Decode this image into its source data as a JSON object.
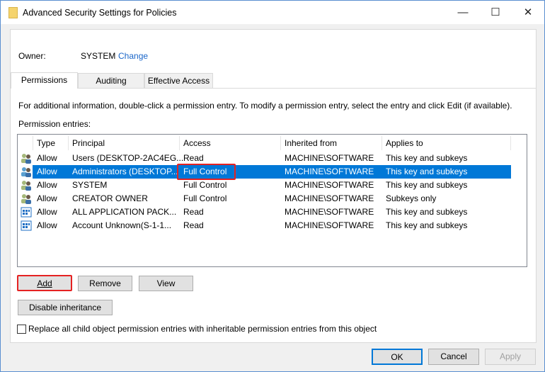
{
  "window": {
    "title": "Advanced Security Settings for Policies",
    "minimize": "—",
    "maximize": "☐",
    "close": "✕"
  },
  "owner": {
    "label": "Owner:",
    "value": "SYSTEM",
    "change_link": "Change"
  },
  "tabs": [
    {
      "label": "Permissions",
      "active": true
    },
    {
      "label": "Auditing"
    },
    {
      "label": "Effective Access"
    }
  ],
  "info_text": "For additional information, double-click a permission entry. To modify a permission entry, select the entry and click Edit (if available).",
  "entries_label": "Permission entries:",
  "columns": [
    "Type",
    "Principal",
    "Access",
    "Inherited from",
    "Applies to"
  ],
  "rows": [
    {
      "icon": "users-icon",
      "type": "Allow",
      "principal": "Users (DESKTOP-2AC4EG...",
      "access": "Read",
      "inherited": "MACHINE\\SOFTWARE",
      "applies": "This key and subkeys"
    },
    {
      "icon": "users-icon",
      "type": "Allow",
      "principal": "Administrators (DESKTOP...",
      "access": "Full Control",
      "inherited": "MACHINE\\SOFTWARE",
      "applies": "This key and subkeys",
      "selected": true
    },
    {
      "icon": "users-icon",
      "type": "Allow",
      "principal": "SYSTEM",
      "access": "Full Control",
      "inherited": "MACHINE\\SOFTWARE",
      "applies": "This key and subkeys"
    },
    {
      "icon": "users-icon",
      "type": "Allow",
      "principal": "CREATOR OWNER",
      "access": "Full Control",
      "inherited": "MACHINE\\SOFTWARE",
      "applies": "Subkeys only"
    },
    {
      "icon": "app-package-icon",
      "type": "Allow",
      "principal": "ALL APPLICATION PACK...",
      "access": "Read",
      "inherited": "MACHINE\\SOFTWARE",
      "applies": "This key and subkeys"
    },
    {
      "icon": "app-package-icon",
      "type": "Allow",
      "principal": "Account Unknown(S-1-1...",
      "access": "Read",
      "inherited": "MACHINE\\SOFTWARE",
      "applies": "This key and subkeys"
    }
  ],
  "buttons": {
    "add": "Add",
    "remove": "Remove",
    "view": "View",
    "disable_inheritance": "Disable inheritance",
    "ok": "OK",
    "cancel": "Cancel",
    "apply": "Apply"
  },
  "replace_checkbox": {
    "label": "Replace all child object permission entries with inheritable permission entries from this object",
    "checked": false
  },
  "colors": {
    "selection": "#0078d7",
    "highlight": "#e52222",
    "link": "#1a66c9"
  }
}
